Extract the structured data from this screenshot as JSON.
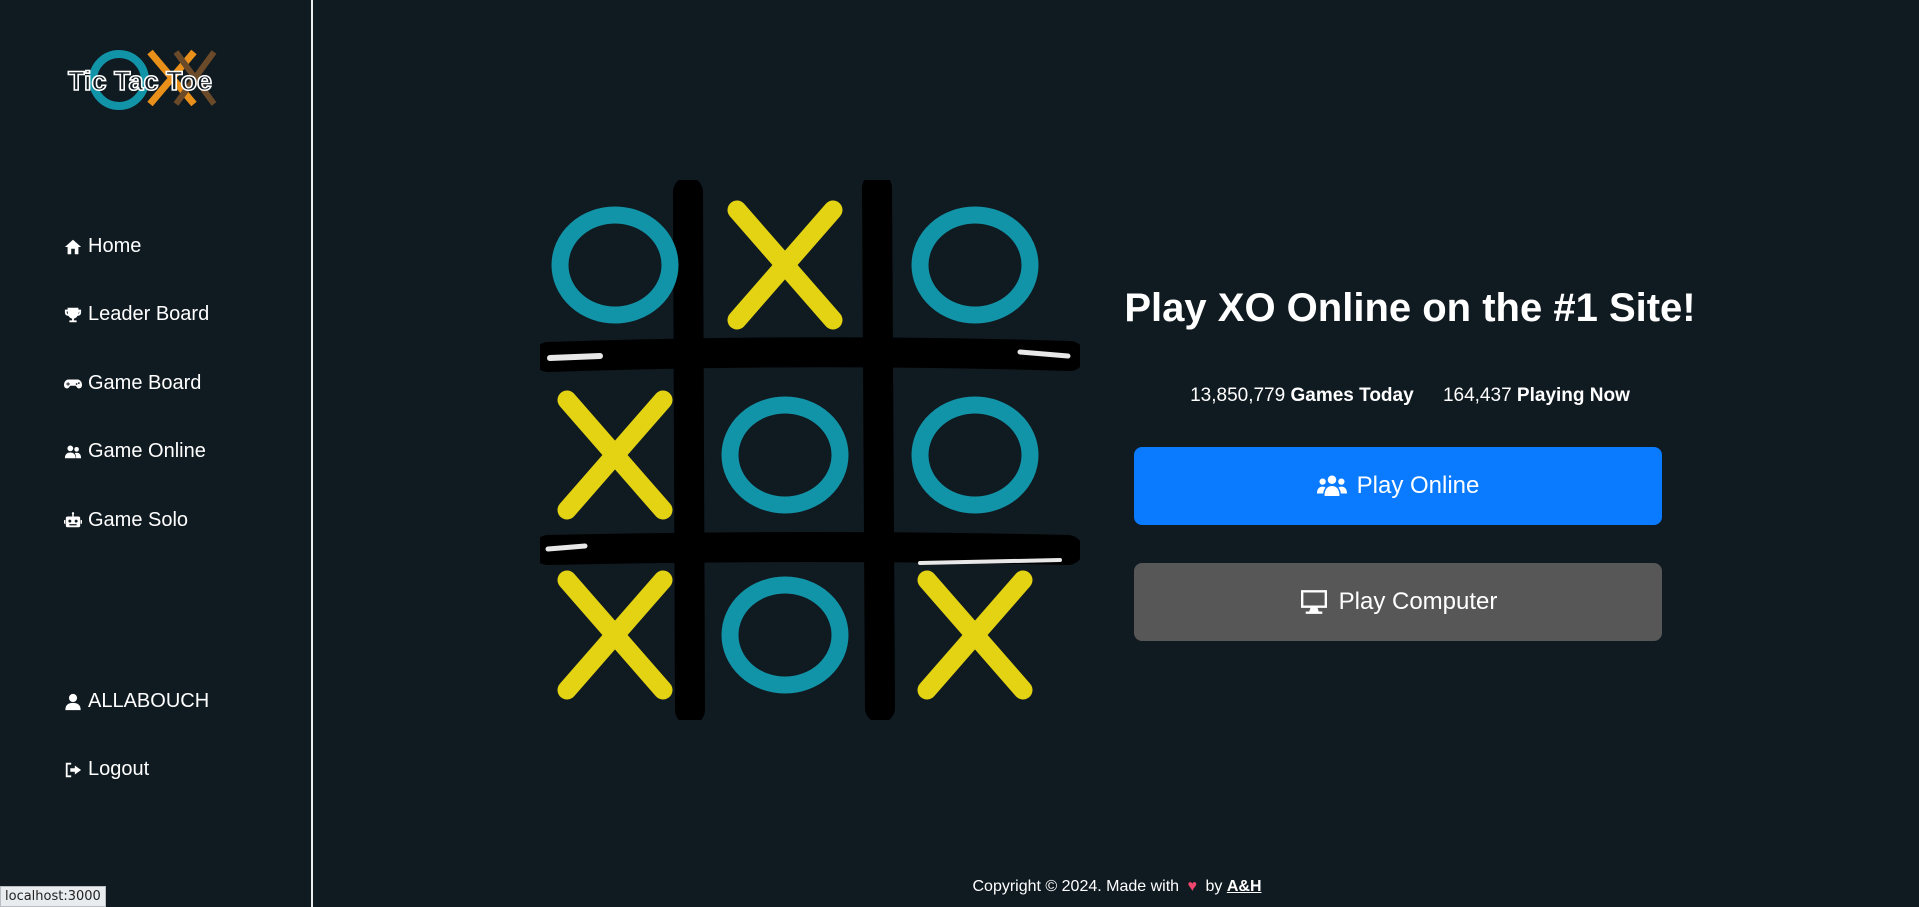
{
  "app": {
    "logo_text": "Tic Tac Toe"
  },
  "sidebar": {
    "items": [
      {
        "label": "Home",
        "icon": "home-icon"
      },
      {
        "label": "Leader Board",
        "icon": "trophy-icon"
      },
      {
        "label": "Game Board",
        "icon": "gamepad-icon"
      },
      {
        "label": "Game Online",
        "icon": "users-icon"
      },
      {
        "label": "Game Solo",
        "icon": "robot-icon"
      }
    ],
    "user": {
      "label": "ALLABOUCH",
      "icon": "user-icon"
    },
    "logout": {
      "label": "Logout",
      "icon": "logout-icon"
    }
  },
  "main": {
    "headline": "Play XO Online on the #1 Site!",
    "stats": {
      "games_today_value": "13,850,779",
      "games_today_label": "Games Today",
      "playing_now_value": "164,437",
      "playing_now_label": "Playing Now"
    },
    "buttons": {
      "online": {
        "label": "Play Online",
        "icon": "users-icon"
      },
      "computer": {
        "label": "Play Computer",
        "icon": "desktop-icon"
      }
    },
    "board": [
      [
        "O",
        "X",
        "O"
      ],
      [
        "X",
        "O",
        "O"
      ],
      [
        "X",
        "O",
        "X"
      ]
    ]
  },
  "footer": {
    "prefix": "Copyright © 2024. Made with",
    "by": "by",
    "author": "A&H"
  },
  "statusbar": {
    "url": "localhost:3000"
  },
  "colors": {
    "o": "#1294a8",
    "x": "#e3d313",
    "online_button": "#0a7bff",
    "computer_button": "#575757",
    "background": "#101a21"
  }
}
